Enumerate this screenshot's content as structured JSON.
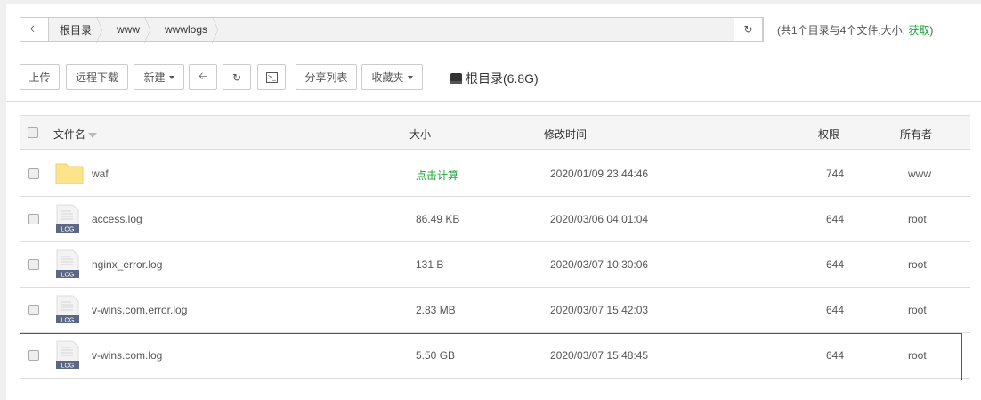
{
  "breadcrumb": {
    "items": [
      "根目录",
      "www",
      "wwwlogs"
    ]
  },
  "summary": {
    "prefix": "(共1个目录与4个文件,大小: ",
    "link": "获取",
    "suffix": ")"
  },
  "toolbar": {
    "upload": "上传",
    "remote_download": "远程下载",
    "new": "新建",
    "share_list": "分享列表",
    "favorites": "收藏夹",
    "disk": "根目录(6.8G)"
  },
  "table": {
    "headers": {
      "name": "文件名",
      "size": "大小",
      "mtime": "修改时间",
      "perm": "权限",
      "owner": "所有者"
    },
    "rows": [
      {
        "name": "waf",
        "type": "folder",
        "size": "点击计算",
        "mtime": "2020/01/09 23:44:46",
        "perm": "744",
        "owner": "www"
      },
      {
        "name": "access.log",
        "type": "log",
        "size": "86.49 KB",
        "mtime": "2020/03/06 04:01:04",
        "perm": "644",
        "owner": "root"
      },
      {
        "name": "nginx_error.log",
        "type": "log",
        "size": "131 B",
        "mtime": "2020/03/07 10:30:06",
        "perm": "644",
        "owner": "root"
      },
      {
        "name": "v-wins.com.error.log",
        "type": "log",
        "size": "2.83 MB",
        "mtime": "2020/03/07 15:42:03",
        "perm": "644",
        "owner": "root"
      },
      {
        "name": "v-wins.com.log",
        "type": "log",
        "size": "5.50 GB",
        "mtime": "2020/03/07 15:48:45",
        "perm": "644",
        "owner": "root"
      }
    ]
  },
  "icon_label": "LOG",
  "colors": {
    "accent": "#20a53a",
    "highlight": "#e02020"
  }
}
